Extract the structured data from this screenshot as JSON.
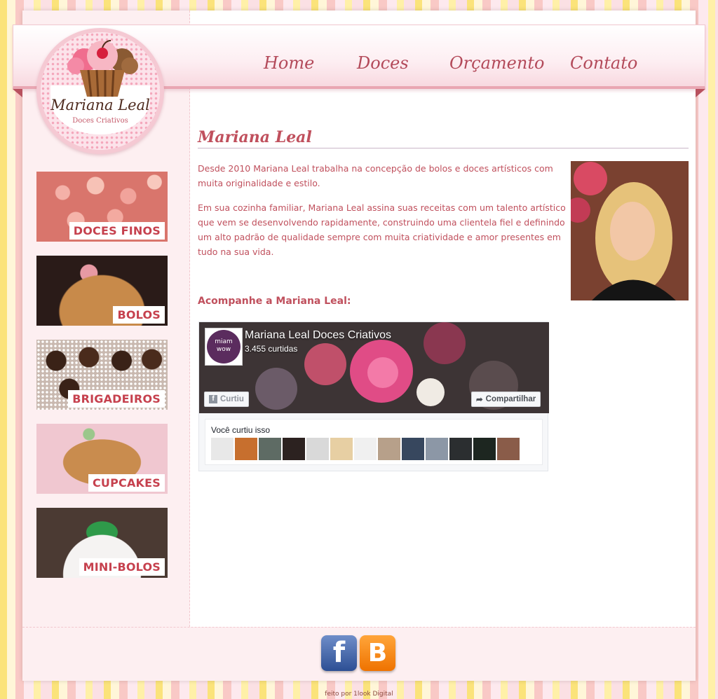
{
  "logo": {
    "title": "Mariana Leal",
    "subtitle": "Doces Criativos"
  },
  "nav": {
    "items": [
      {
        "label": "Home"
      },
      {
        "label": "Doces"
      },
      {
        "label": "Orçamento"
      },
      {
        "label": "Contato"
      }
    ]
  },
  "sidebar": {
    "categories": [
      {
        "label": "DOCES FINOS"
      },
      {
        "label": "BOLOS"
      },
      {
        "label": "BRIGADEIROS"
      },
      {
        "label": "CUPCAKES"
      },
      {
        "label": "MINI-BOLOS"
      }
    ]
  },
  "main": {
    "heading": "Mariana Leal",
    "paragraphs": [
      "Desde 2010 Mariana Leal trabalha na concepção de bolos e doces artísticos com muita originalidade e estilo.",
      "Em sua cozinha familiar, Mariana Leal assina suas receitas com um talento artístico que vem se desenvolvendo rapidamente, construindo uma clientela fiel e definindo um alto padrão de qualidade sempre com muita criatividade e amor presentes em tudo na sua vida."
    ],
    "follow_heading": "Acompanhe a Mariana Leal:"
  },
  "facebook": {
    "page_name": "Mariana Leal Doces Criativos",
    "likes": "3.455 curtidas",
    "liked_button": "Curtiu",
    "share_button": "Compartilhar",
    "you_liked": "Você curtiu isso",
    "avatar_text": "miam wow"
  },
  "footer": {
    "credit": "feito por 1look Digital"
  },
  "colors": {
    "accent": "#c0505d",
    "facebook_blue": "#3b5998",
    "blogger_orange": "#f57d00"
  }
}
